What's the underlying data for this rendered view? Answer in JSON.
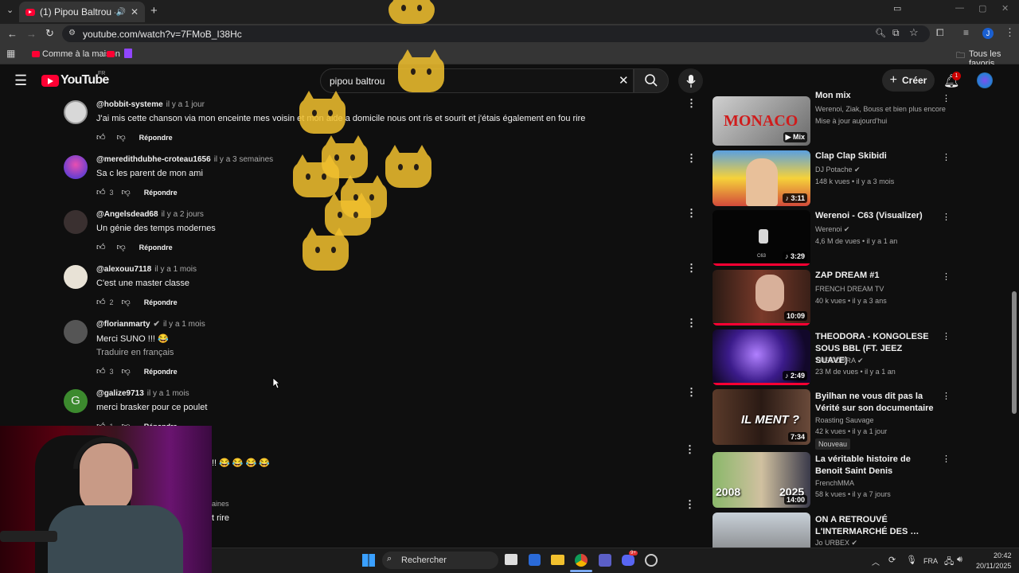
{
  "browser": {
    "tab_title": "(1) Pipou Baltrou - YouTube",
    "url": "youtube.com/watch?v=7FMoB_I38Hc",
    "bookmark_home": "Comme à la maison",
    "all_bookmarks": "Tous les favoris",
    "profile_initial": "J"
  },
  "youtube": {
    "logo_text": "YouTube",
    "region": "FR",
    "search_value": "pipou baltrou",
    "create_label": "Créer",
    "notification_count": "1"
  },
  "comments": [
    {
      "handle": "@hobbit-systeme",
      "time": "il y a 1 jour",
      "text": "J'ai mis cette chanson via mon enceinte mes voisin et mon aide a domicile nous ont ris et sourit et j'étais également en fou rire",
      "likes": "",
      "reply": "Répondre",
      "avatar_color": "#d8d8d8"
    },
    {
      "handle": "@meredithdubhe-croteau1656",
      "time": "il y a 3 semaines",
      "text": "Sa c les parent de mon ami",
      "likes": "3",
      "reply": "Répondre",
      "avatar_color": "#6a3fd0"
    },
    {
      "handle": "@Angelsdead68",
      "time": "il y a 2 jours",
      "text": "Un génie des temps modernes",
      "likes": "",
      "reply": "Répondre",
      "avatar_color": "#3a3030"
    },
    {
      "handle": "@alexouu7118",
      "time": "il y a 1 mois",
      "text": "C'est une master classe",
      "likes": "2",
      "reply": "Répondre",
      "avatar_color": "#e8e2d6"
    },
    {
      "handle": "@florianmarty",
      "time": "il y a 1 mois",
      "text": "Merci SUNO !!! 😂",
      "translate": "Traduire en français",
      "likes": "3",
      "reply": "Répondre",
      "avatar_color": "#555"
    },
    {
      "handle": "@galize9713",
      "time": "il y a 1 mois",
      "text": "merci brasker pour ce poulet",
      "likes": "1",
      "reply": "Répondre",
      "avatar_color": "#3c8a2e",
      "avatar_letter": "G"
    }
  ],
  "partial_comments": {
    "emoji_line": "!! 😂 😂 😂 😂",
    "time_fragment": "aines",
    "text_fragment": "t rire"
  },
  "sidebar": [
    {
      "title": "Mon mix",
      "channel": "Werenoi, Ziak, Bouss et bien plus encore",
      "meta": "Mise à jour aujourd'hui",
      "badge_text": "Mix",
      "thumb_text": "MONACO",
      "thumb_color": "#b9b9b9"
    },
    {
      "title": "Clap Clap Skibidi",
      "channel": "DJ Potache",
      "verified": true,
      "meta": "148 k vues • il y a 3 mois",
      "duration": "3:11",
      "thumb_color": "#4a86c8"
    },
    {
      "title": "Werenoi - C63 (Visualizer)",
      "channel": "Werenoi",
      "verified": true,
      "meta": "4,6 M de vues • il y a 1 an",
      "duration": "3:29",
      "thumb_caption": "C63",
      "thumb_color": "#050505",
      "progress": 1.0
    },
    {
      "title": "ZAP DREAM #1",
      "channel": "FRENCH DREAM TV",
      "meta": "40 k vues • il y a 3 ans",
      "duration": "10:09",
      "thumb_color": "#5a2a22",
      "progress": 1.0
    },
    {
      "title": "THEODORA - KONGOLESE SOUS BBL (FT. JEEZ SUAVE)",
      "channel": "THEODORA",
      "verified": true,
      "meta": "23 M de vues • il y a 1 an",
      "duration": "2:49",
      "thumb_color": "#3b1b8a",
      "progress": 1.0
    },
    {
      "title": "Byilhan ne vous dit pas la Vérité sur son documentaire",
      "channel": "Roasting Sauvage",
      "meta": "42 k vues • il y a 1 jour",
      "badge": "Nouveau",
      "duration": "7:34",
      "thumb_text": "IL MENT ?",
      "thumb_color": "#3d2a22"
    },
    {
      "title": "La véritable histoire de Benoit Saint Denis",
      "channel": "FrenchMMA",
      "meta": "58 k vues • il y a 7 jours",
      "duration": "14:00",
      "thumb_text_left": "2008",
      "thumb_text_right": "2025",
      "thumb_color": "#6a8a4a"
    },
    {
      "title": "ON A RETROUVÉ L'INTERMARCHÉ DES …",
      "channel": "Jo URBEX",
      "verified": true,
      "meta": "",
      "thumb_color": "#8a8a8a"
    }
  ],
  "taskbar": {
    "search_placeholder": "Rechercher",
    "language": "FRA",
    "time": "20:42",
    "date": "20/11/2025",
    "discord_badge": "9+"
  },
  "icons": [
    "menu-icon",
    "search-icon",
    "mic-icon",
    "bell-icon",
    "close-icon",
    "kebab-icon",
    "like-icon",
    "dislike-icon",
    "back-icon",
    "forward-icon",
    "reload-icon",
    "star-icon",
    "windows-icon"
  ]
}
